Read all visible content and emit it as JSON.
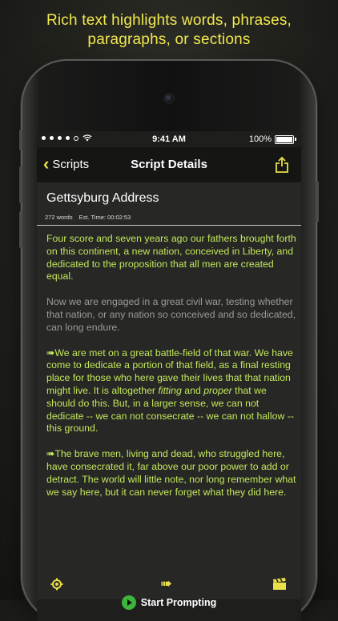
{
  "banner": {
    "line1": "Rich text highlights words, phrases,",
    "line2": "paragraphs, or sections"
  },
  "status": {
    "time": "9:41 AM",
    "battery": "100%"
  },
  "nav": {
    "back_label": "Scripts",
    "title": "Script Details",
    "share_icon": "share-icon"
  },
  "script": {
    "title": "Gettsyburg Address",
    "word_count": "272 words",
    "est_time": "Est. Time: 00:02:53"
  },
  "paragraphs": {
    "p1": "Four score and seven years ago our fathers brought forth on this continent, a new nation, conceived in Liberty, and dedicated to the proposition that all men are created equal.",
    "p2": "Now we are engaged in a great civil war, testing whether that nation, or any nation so conceived and so dedicated, can long endure.",
    "p3_marker": "➠",
    "p3_a": "We are met on a great battle-field of that war. We have come to dedicate a portion of that field, as a final resting place for those who here gave their lives that that nation might live. It is altogether ",
    "p3_fitting": "fitting",
    "p3_b": " and ",
    "p3_proper": "proper",
    "p3_c": " that we should do this. But, in a larger sense, we can not dedicate -- we can not consecrate -- we can not hallow -- this ground.",
    "p4_marker": "➠",
    "p4": "The brave men, living and dead, who struggled here, have consecrated it, far above our poor power to add or detract. The world will little note, nor long remember what we say here, but it can never forget what they did here."
  },
  "actions": {
    "start_label": "Start Prompting"
  },
  "toolbar": {
    "icons": [
      "gear-icon",
      "highlight-arrow-icon",
      "clapperboard-icon"
    ]
  },
  "colors": {
    "accent": "#e9e04a",
    "highlight": "#c2e85a",
    "play": "#3fb43a"
  }
}
